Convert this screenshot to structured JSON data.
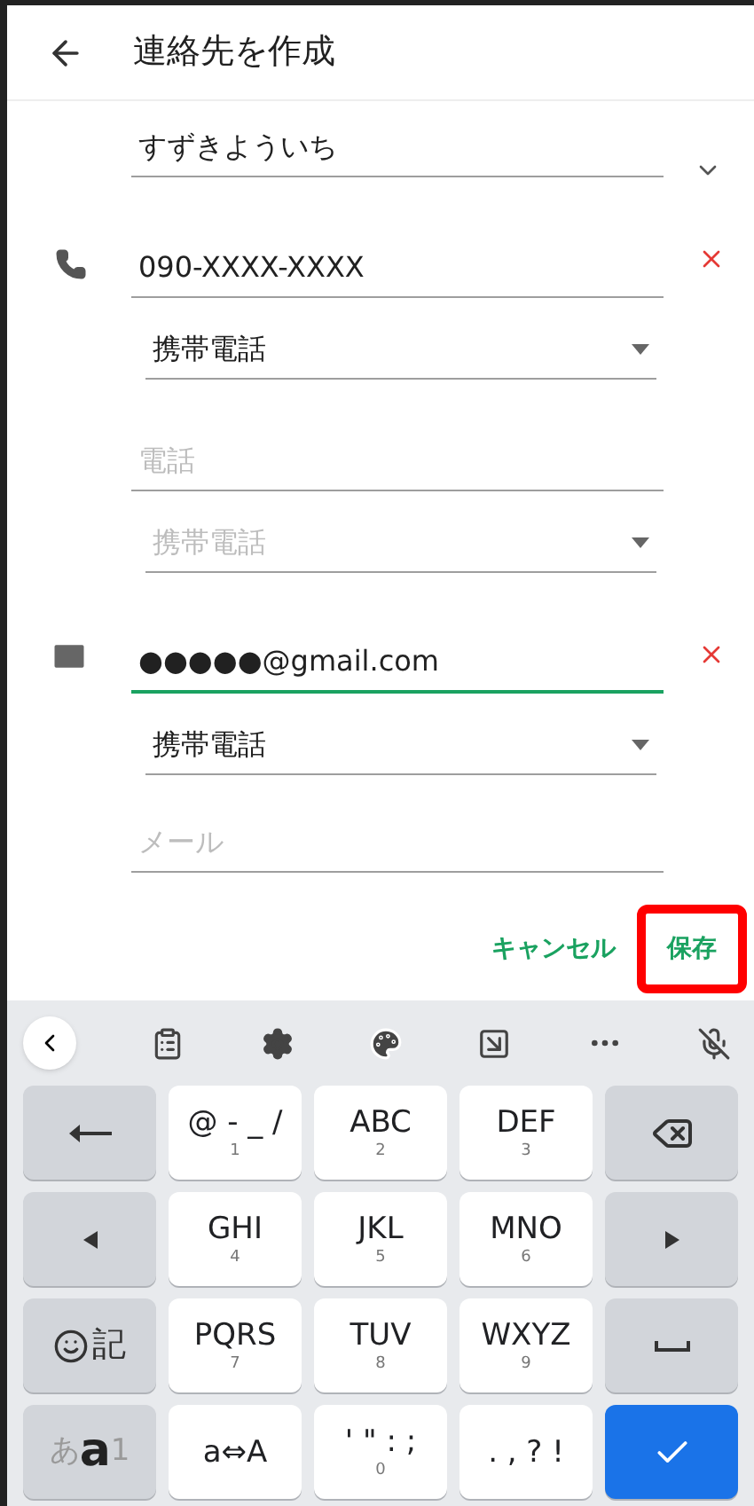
{
  "header": {
    "title": "連絡先を作成"
  },
  "name_field": {
    "value": "すずきよういち"
  },
  "phone_fields": [
    {
      "value": "090-XXXX-XXXX",
      "type": "携帯電話",
      "type_disabled": false,
      "removable": true
    },
    {
      "placeholder": "電話",
      "type": "携帯電話",
      "type_disabled": true,
      "removable": false
    }
  ],
  "email_fields": [
    {
      "value": "●●●●●@gmail.com",
      "focused": true,
      "type": "携帯電話",
      "type_disabled": false,
      "removable": true
    },
    {
      "placeholder": "メール",
      "focused": false
    }
  ],
  "actions": {
    "cancel": "キャンセル",
    "save": "保存",
    "save_highlighted": true
  },
  "keyboard": {
    "rows": [
      [
        {
          "kind": "undo"
        },
        {
          "kind": "key",
          "label": "@ - _ /",
          "sub": "1"
        },
        {
          "kind": "key",
          "label": "ABC",
          "sub": "2"
        },
        {
          "kind": "key",
          "label": "DEF",
          "sub": "3"
        },
        {
          "kind": "backspace"
        }
      ],
      [
        {
          "kind": "left"
        },
        {
          "kind": "key",
          "label": "GHI",
          "sub": "4"
        },
        {
          "kind": "key",
          "label": "JKL",
          "sub": "5"
        },
        {
          "kind": "key",
          "label": "MNO",
          "sub": "6"
        },
        {
          "kind": "right"
        }
      ],
      [
        {
          "kind": "emoji",
          "label": "記"
        },
        {
          "kind": "key",
          "label": "PQRS",
          "sub": "7"
        },
        {
          "kind": "key",
          "label": "TUV",
          "sub": "8"
        },
        {
          "kind": "key",
          "label": "WXYZ",
          "sub": "9"
        },
        {
          "kind": "space"
        }
      ],
      [
        {
          "kind": "mode",
          "options": [
            {
              "label": "あ",
              "selected": false
            },
            {
              "label": "a",
              "selected": true
            },
            {
              "label": "1",
              "selected": false
            }
          ]
        },
        {
          "kind": "key",
          "label": "a⇔A"
        },
        {
          "kind": "key",
          "label": "' \" : ;",
          "sub": "0"
        },
        {
          "kind": "key",
          "label": ". , ? !"
        },
        {
          "kind": "confirm"
        }
      ]
    ]
  }
}
